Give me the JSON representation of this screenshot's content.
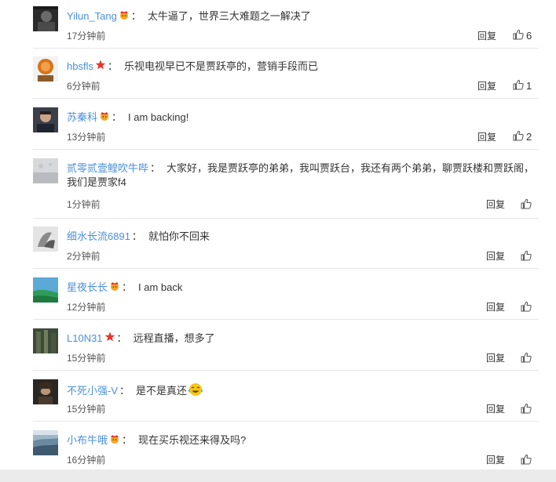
{
  "comments": [
    {
      "username": "Yilun_Tang",
      "badge": "crown",
      "text": "太牛逼了，世界三大难题之一解决了",
      "time": "17分钟前",
      "reply": "回复",
      "likes": "6"
    },
    {
      "username": "hbsfls",
      "badge": "star",
      "text": "乐视电视早已不是贾跃亭的，营销手段而已",
      "time": "6分钟前",
      "reply": "回复",
      "likes": "1"
    },
    {
      "username": "苏秦科",
      "badge": "crown",
      "text": "I am backing!",
      "time": "13分钟前",
      "reply": "回复",
      "likes": "2"
    },
    {
      "username": "贰零贰壹鳇吹牛哔",
      "badge": "",
      "text": "大家好，我是贾跃亭的弟弟，我叫贾跃台，我还有两个弟弟，聊贾跃楼和贾跃阁，我们是贾家f4",
      "time": "1分钟前",
      "reply": "回复",
      "likes": ""
    },
    {
      "username": "细水长流6891",
      "badge": "",
      "text": "就怕你不回来",
      "time": "2分钟前",
      "reply": "回复",
      "likes": ""
    },
    {
      "username": "星夜长长",
      "badge": "crown",
      "text": "I am back",
      "time": "12分钟前",
      "reply": "回复",
      "likes": ""
    },
    {
      "username": "L10N31",
      "badge": "star",
      "text": "远程直播，想多了",
      "time": "15分钟前",
      "reply": "回复",
      "likes": ""
    },
    {
      "username": "不死小强-V",
      "badge": "",
      "text": "是不是真还",
      "time": "15分钟前",
      "reply": "回复",
      "likes": "",
      "emoji": "laugh-cry-emoji"
    },
    {
      "username": "小布牛哦",
      "badge": "crown",
      "text": "现在买乐视还来得及吗?",
      "time": "16分钟前",
      "reply": "回复",
      "likes": ""
    }
  ],
  "colors": {
    "username": "#4a90d9",
    "star": "#e8352c",
    "crown": "#f5a623",
    "divider": "#e6e6e6"
  }
}
